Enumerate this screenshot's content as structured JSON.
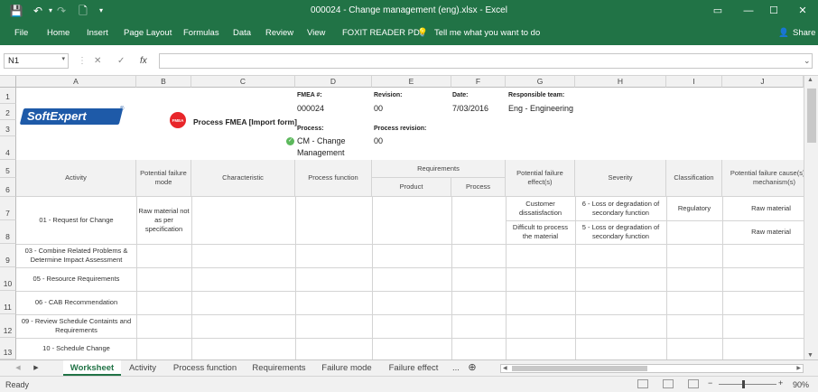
{
  "titlebar": {
    "title": "000024 - Change management (eng).xlsx  -  Excel",
    "save_icon": "💾",
    "undo_icon": "↶",
    "redo_icon": "↷",
    "new_icon": "🗋",
    "customize_icon": "▾",
    "ribbon_display_icon": "▭",
    "minimize": "—",
    "maximize": "☐",
    "close": "✕"
  },
  "ribbon": {
    "tabs": [
      "File",
      "Home",
      "Insert",
      "Page Layout",
      "Formulas",
      "Data",
      "Review",
      "View",
      "FOXIT READER PDF"
    ],
    "tell_me": "Tell me what you want to do",
    "tell_me_icon": "💡",
    "share": "Share",
    "share_icon": "👤"
  },
  "formula": {
    "name_box": "N1",
    "name_dd": "▾",
    "cancel": "✕",
    "enter": "✓",
    "fx": "fx",
    "value": "",
    "expand": "⌄"
  },
  "columns": [
    "A",
    "B",
    "C",
    "D",
    "E",
    "F",
    "G",
    "H",
    "I",
    "J"
  ],
  "rows": [
    "1",
    "2",
    "3",
    "4",
    "5",
    "6",
    "7",
    "8",
    "9",
    "10",
    "11",
    "12",
    "13"
  ],
  "sheet": {
    "logo_soft": "Soft",
    "logo_expert": "Expert",
    "logo_reg": "®",
    "fmea_badge": "FMEA",
    "process_title": "Process FMEA [Import form]",
    "fmea_no_label": "FMEA #:",
    "fmea_no": "000024",
    "revision_label": "Revision:",
    "revision": "00",
    "date_label": "Date:",
    "date": "7/03/2016",
    "team_label": "Responsible team:",
    "team": "Eng - Engineering",
    "process_label": "Process:",
    "process": "CM - Change Management",
    "process_revision_label": "Process revision:",
    "process_revision": "00",
    "headers": {
      "activity": "Activity",
      "failure_mode": "Potential failure mode",
      "characteristic": "Characteristic",
      "process_function": "Process function",
      "requirements": "Requirements",
      "product": "Product",
      "process": "Process",
      "failure_effects": "Potential failure effect(s)",
      "severity": "Severity",
      "classification": "Classification",
      "failure_causes": "Potential failure cause(s) and mechanism(s)"
    },
    "activities": [
      "01 - Request for Change",
      "03 - Combine Related Problems & Determine Impact Assessment",
      "05 - Resource Requirements",
      "06 - CAB Recommendation",
      "09 - Review Schedule Containts and Requirements",
      "10 - Schedule Change"
    ],
    "failure_mode_1": "Raw material not as per specification",
    "effects": [
      "Customer dissatisfaction",
      "Difficult to process the material"
    ],
    "severities": [
      "6 - Loss or degradation of secondary function",
      "5 - Loss or degradation of secondary function"
    ],
    "classification_1": "Regulatory",
    "causes": [
      "Raw material",
      "Raw material"
    ]
  },
  "sheets": {
    "tabs": [
      "Worksheet",
      "Activity",
      "Process function",
      "Requirements",
      "Failure mode",
      "Failure effect"
    ],
    "more": "...",
    "add": "⊕",
    "prev": "◀",
    "next": "▶"
  },
  "status": {
    "ready": "Ready",
    "zoom": "90%",
    "zoom_minus": "−",
    "zoom_plus": "+"
  },
  "colors": {
    "excel_green": "#217346",
    "logo_blue": "#1e5aa8",
    "logo_red": "#e8262a"
  }
}
